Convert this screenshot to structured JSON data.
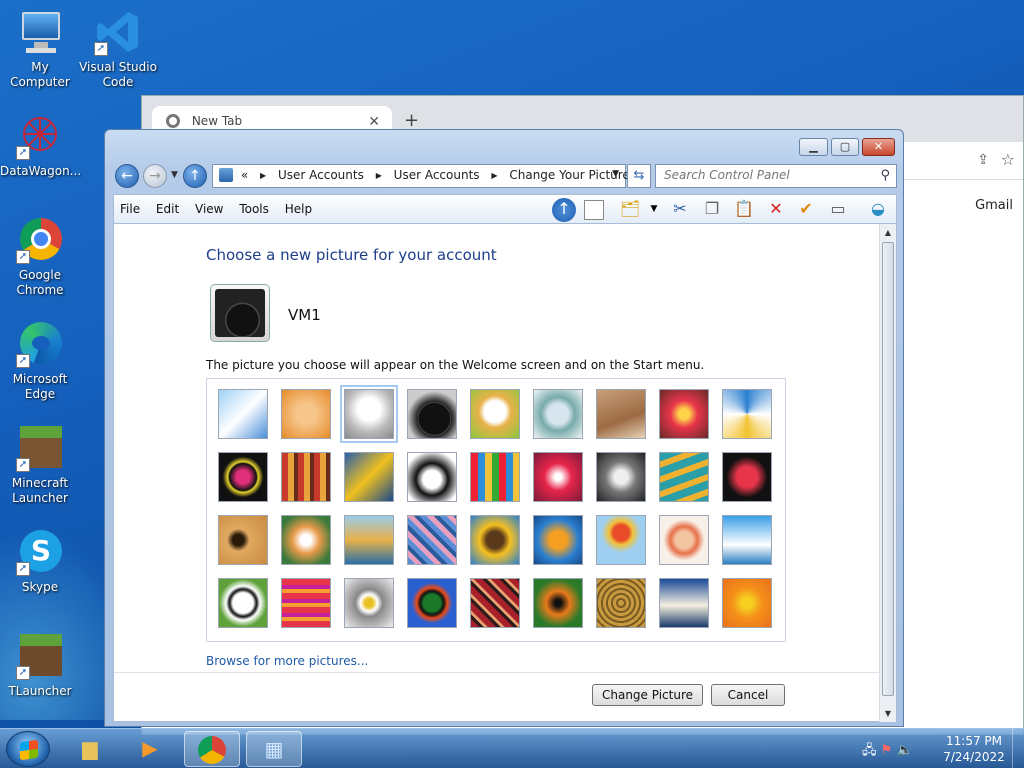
{
  "desktop": {
    "icons": [
      {
        "label": "My Computer",
        "icon": "computer-icon"
      },
      {
        "label": "Visual Studio Code",
        "icon": "vscode-icon"
      },
      {
        "label": "DataWagon...",
        "icon": "datawagon-icon"
      },
      {
        "label": "Google Chrome",
        "icon": "chrome-icon"
      },
      {
        "label": "Microsoft Edge",
        "icon": "edge-icon"
      },
      {
        "label": "Minecraft Launcher",
        "icon": "minecraft-icon"
      },
      {
        "label": "Skype",
        "icon": "skype-icon"
      },
      {
        "label": "TLauncher",
        "icon": "tlauncher-icon"
      }
    ]
  },
  "chrome": {
    "tab_title": "New Tab",
    "gmail_label": "Gmail"
  },
  "window": {
    "breadcrumb_prefix": "«",
    "breadcrumb": [
      "User Accounts",
      "User Accounts",
      "Change Your Picture"
    ],
    "search_placeholder": "Search Control Panel",
    "menu": [
      "File",
      "Edit",
      "View",
      "Tools",
      "Help"
    ],
    "heading": "Choose a new picture for your account",
    "username": "VM1",
    "description": "The picture you choose will appear on the Welcome screen and on the Start menu.",
    "pictures": [
      "roller-coaster",
      "starfish",
      "robot-toy",
      "turntable",
      "lucky-cat",
      "gyroscope",
      "kitten",
      "flower",
      "pinwheel",
      "ball",
      "fabric",
      "leaf",
      "dog",
      "crayons",
      "star-lantern",
      "jacks",
      "stairs",
      "paper-crane",
      "guitar",
      "puppy",
      "tin-robot",
      "cloth",
      "sunflower",
      "fish",
      "balloon",
      "doll",
      "sailboat",
      "soccer-ball",
      "stripes",
      "marbles",
      "window",
      "rug",
      "butterfly",
      "basket",
      "lighthouse",
      "orange-flower"
    ],
    "selected_index": 2,
    "browse_link": "Browse for more pictures...",
    "change_button": "Change Picture",
    "cancel_button": "Cancel"
  },
  "taskbar": {
    "clock_time": "11:57 PM",
    "clock_date": "7/24/2022"
  },
  "colors": {
    "desktop_blue": "#1560bd",
    "heading_blue": "#1e3e8a",
    "link_blue": "#1f5aa8"
  }
}
